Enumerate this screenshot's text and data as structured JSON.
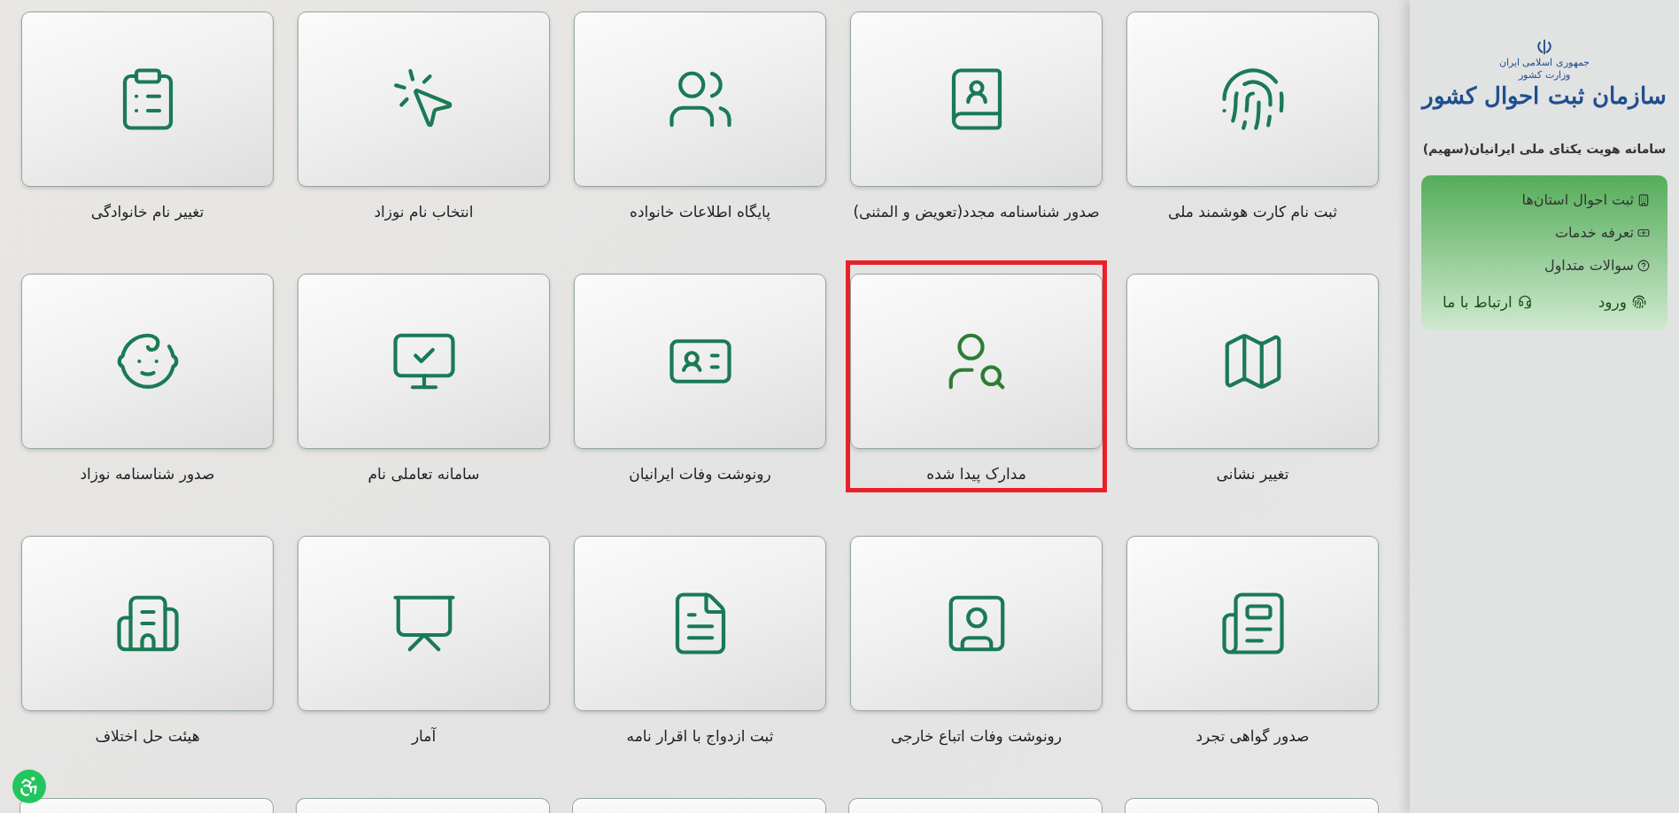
{
  "sidebar": {
    "logo": {
      "line_1": "جمهوری اسلامی ایران",
      "line_2": "وزارت کشور",
      "line_3": "سازمان ثبت احوال کشور"
    },
    "title": "سامانه هویت یکتای ملی ایرانیان(سهیم)",
    "menu": [
      {
        "label": "ثبت احوال استان‌ها"
      },
      {
        "label": "تعرفه خدمات"
      },
      {
        "label": "سوالات متداول"
      }
    ],
    "links": [
      {
        "label": "ورود"
      },
      {
        "label": "ارتباط با ما"
      }
    ]
  },
  "services": [
    {
      "label": "ثبت نام کارت هوشمند ملی",
      "highlighted": false
    },
    {
      "label": "صدور شناسنامه مجدد(تعویض و المثنی)",
      "highlighted": false
    },
    {
      "label": "پایگاه اطلاعات خانواده",
      "highlighted": false
    },
    {
      "label": "انتخاب نام نوزاد",
      "highlighted": false
    },
    {
      "label": "تغییر نام خانوادگی",
      "highlighted": false
    },
    {
      "label": "تغییر نشانی",
      "highlighted": false
    },
    {
      "label": "مدارک پیدا شده",
      "highlighted": true
    },
    {
      "label": "رونوشت وفات ایرانیان",
      "highlighted": false
    },
    {
      "label": "سامانه تعاملی نام",
      "highlighted": false
    },
    {
      "label": "صدور شناسنامه نوزاد",
      "highlighted": false
    },
    {
      "label": "صدور گواهی تجرد",
      "highlighted": false
    },
    {
      "label": "رونوشت وفات اتباع خارجی",
      "highlighted": false
    },
    {
      "label": "ثبت ازدواج با اقرار نامه",
      "highlighted": false
    },
    {
      "label": "آمار",
      "highlighted": false
    },
    {
      "label": "هیئت حل اختلاف",
      "highlighted": false
    }
  ]
}
